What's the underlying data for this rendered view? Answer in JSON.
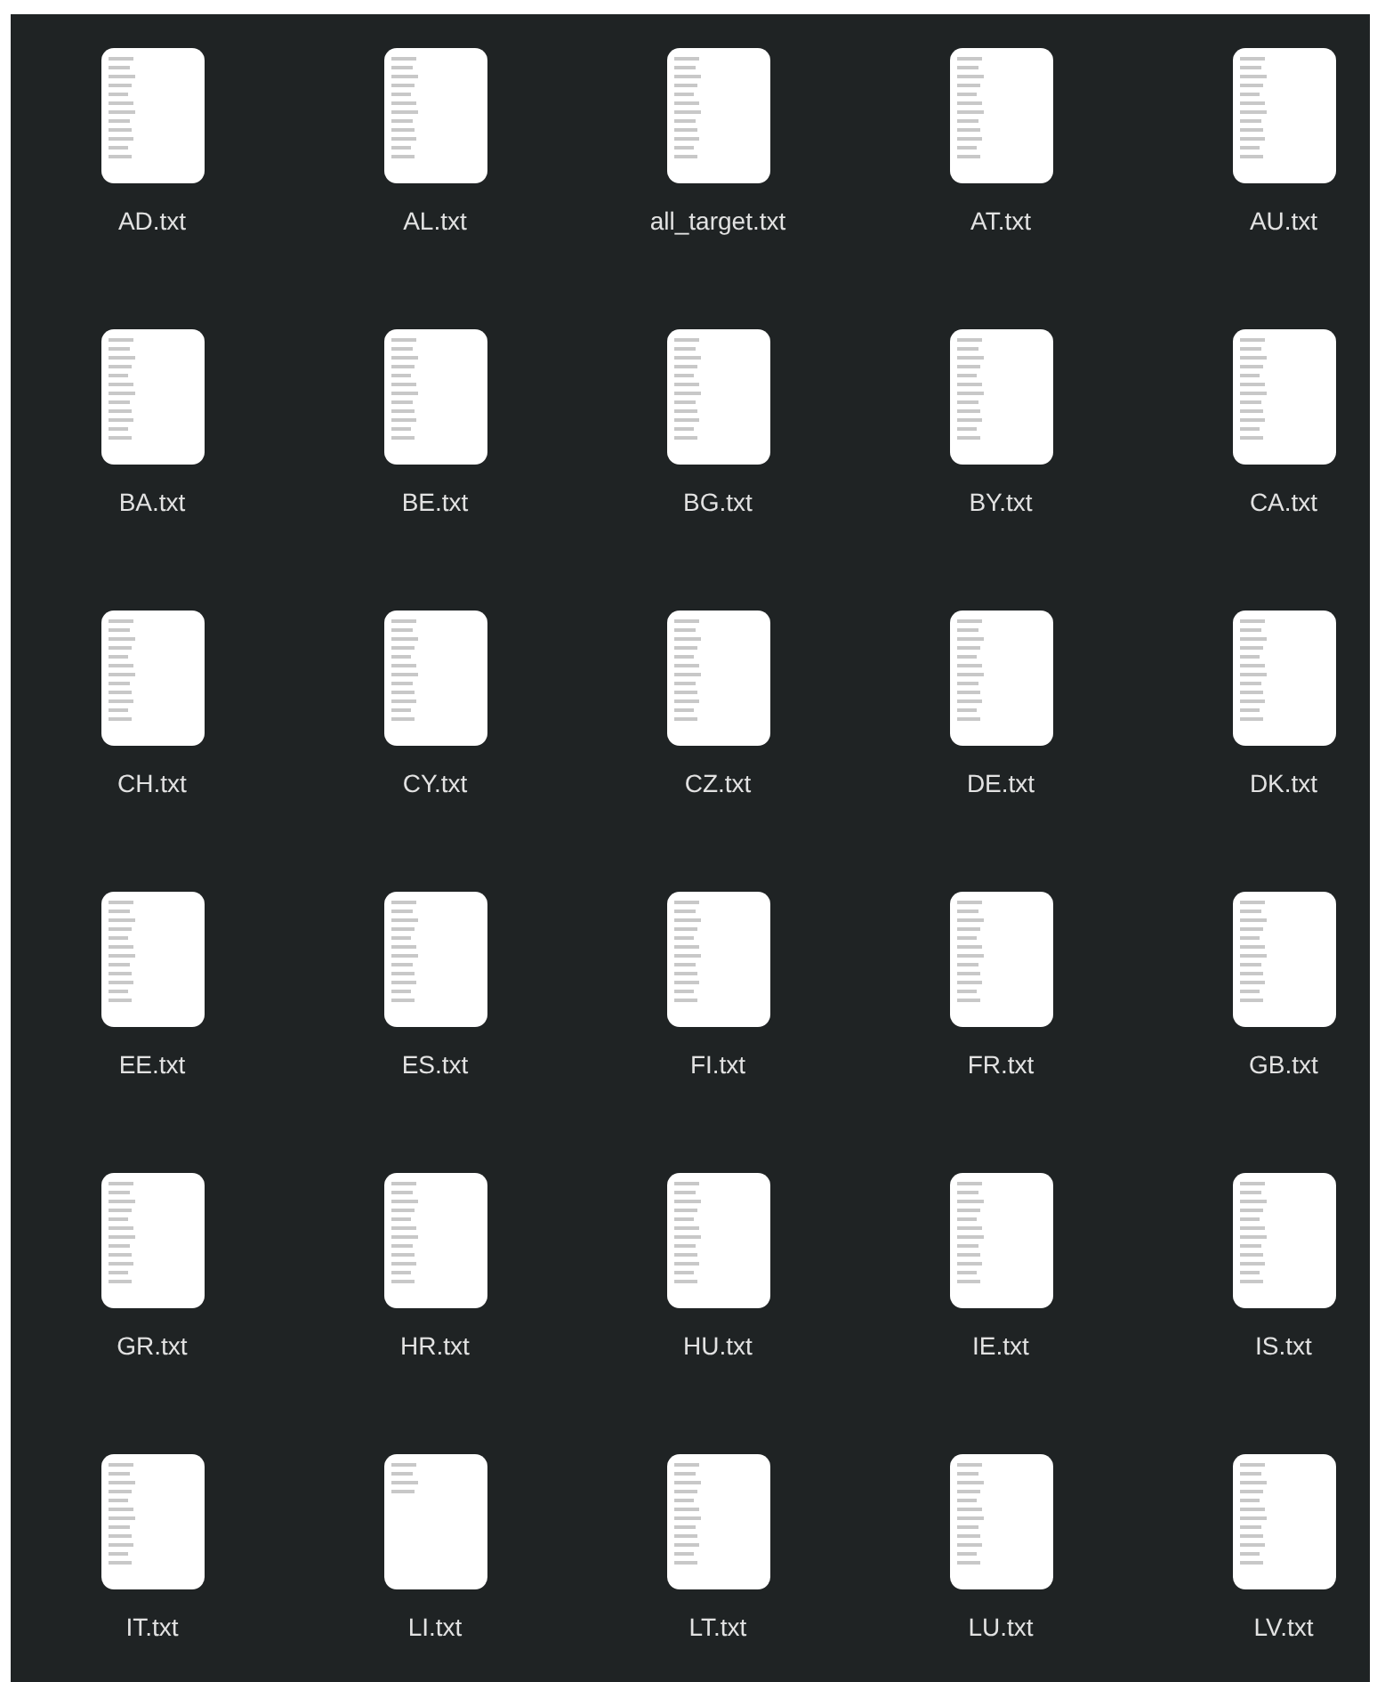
{
  "files": [
    {
      "name": "AD.txt",
      "kind": "full"
    },
    {
      "name": "AL.txt",
      "kind": "full"
    },
    {
      "name": "all_target.txt",
      "kind": "full"
    },
    {
      "name": "AT.txt",
      "kind": "full"
    },
    {
      "name": "AU.txt",
      "kind": "full"
    },
    {
      "name": "BA.txt",
      "kind": "full"
    },
    {
      "name": "BE.txt",
      "kind": "full"
    },
    {
      "name": "BG.txt",
      "kind": "full"
    },
    {
      "name": "BY.txt",
      "kind": "full"
    },
    {
      "name": "CA.txt",
      "kind": "full"
    },
    {
      "name": "CH.txt",
      "kind": "full"
    },
    {
      "name": "CY.txt",
      "kind": "full"
    },
    {
      "name": "CZ.txt",
      "kind": "full"
    },
    {
      "name": "DE.txt",
      "kind": "full"
    },
    {
      "name": "DK.txt",
      "kind": "full"
    },
    {
      "name": "EE.txt",
      "kind": "full"
    },
    {
      "name": "ES.txt",
      "kind": "full"
    },
    {
      "name": "FI.txt",
      "kind": "full"
    },
    {
      "name": "FR.txt",
      "kind": "full"
    },
    {
      "name": "GB.txt",
      "kind": "full"
    },
    {
      "name": "GR.txt",
      "kind": "full"
    },
    {
      "name": "HR.txt",
      "kind": "full"
    },
    {
      "name": "HU.txt",
      "kind": "full"
    },
    {
      "name": "IE.txt",
      "kind": "full"
    },
    {
      "name": "IS.txt",
      "kind": "full"
    },
    {
      "name": "IT.txt",
      "kind": "full"
    },
    {
      "name": "LI.txt",
      "kind": "short"
    },
    {
      "name": "LT.txt",
      "kind": "full"
    },
    {
      "name": "LU.txt",
      "kind": "full"
    },
    {
      "name": "LV.txt",
      "kind": "full"
    }
  ]
}
